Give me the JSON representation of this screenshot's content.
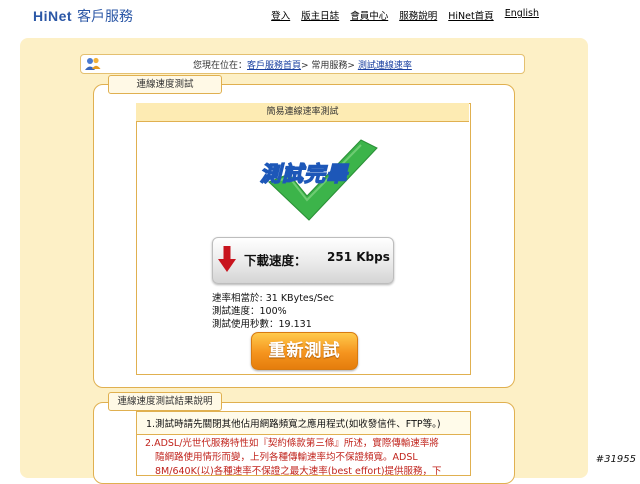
{
  "header": {
    "logo_brand": "HiNet",
    "logo_service": "客戶服務",
    "nav": [
      "登入",
      "版主日誌",
      "會員中心",
      "服務說明",
      "HiNet首頁",
      "English"
    ]
  },
  "breadcrumb": {
    "prefix": "您現在位在：",
    "link1": "客戶服務首頁",
    "sep1": "> 常用服務> ",
    "link2": "測試連線速率"
  },
  "speed_section": {
    "tab_title": "連線速度測試",
    "panel_title": "簡易連線速率測試",
    "complete_text": "測試完畢",
    "download_label": "下載速度：",
    "download_value": "251 Kbps",
    "rate_line": "速率相當於: 31 KBytes/Sec",
    "progress_line": "測試進度：100%",
    "seconds_line": "測試使用秒數：19.131",
    "retest_button": "重新測試"
  },
  "notes_section": {
    "tab_title": "連線速度測試結果說明",
    "note1": "1.測試時請先關閉其他佔用網路頻寬之應用程式(如收發信件、FTP等。)",
    "note2_line1": "2.ADSL/光世代服務特性如『契約條款第三條』所述，實際傳輸速率將",
    "note2_line2": "隨網路使用情形而變，上列各種傳輸速率均不保證頻寬。ADSL",
    "note2_line3": "8M/640K(以)各種速率不保證之最大速率(best effort)提供服務，下"
  },
  "watermark": "#31955",
  "colors": {
    "brand_blue": "#2b57a6",
    "panel_bg": "#fdf0c6",
    "border_gold": "#e0b050",
    "retest_orange": "#f5941e",
    "check_green": "#3cb44a",
    "arrow_red": "#c8141e"
  }
}
